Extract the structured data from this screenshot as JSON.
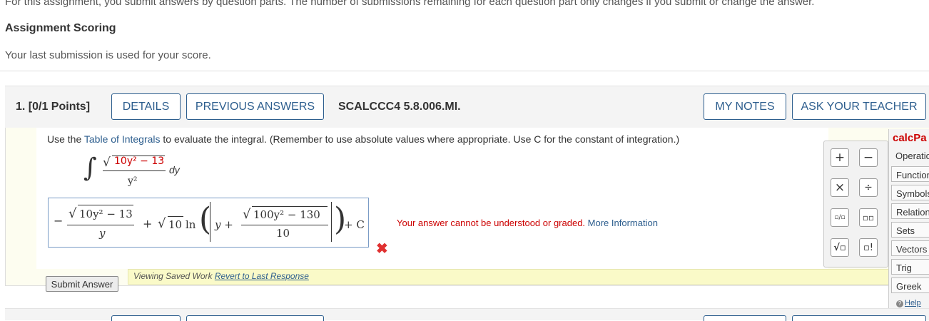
{
  "header": {
    "intro_text": "For this assignment, you submit answers by question parts. The number of submissions remaining for each question part only changes if you submit or change the answer.",
    "scoring_heading": "Assignment Scoring",
    "scoring_text": "Your last submission is used for your score."
  },
  "question": {
    "number_label": "1.  [0/1 Points]",
    "details_label": "DETAILS",
    "previous_answers_label": "PREVIOUS ANSWERS",
    "question_id": "SCALCCC4 5.8.006.MI.",
    "my_notes_label": "MY NOTES",
    "ask_teacher_label": "ASK YOUR TEACHER",
    "prompt_pre": "Use the ",
    "prompt_link": "Table of Integrals",
    "prompt_post": " to evaluate the integral. (Remember to use absolute values where appropriate. Use C for the constant of integration.)",
    "integral_numerator": "10y² − 13",
    "integral_denominator": "y²",
    "integral_dy": "dy",
    "answer": {
      "minus": "−",
      "frac1_num": "10y² − 13",
      "frac1_den": "y",
      "plus1": "+",
      "sqrt2": "10",
      "ln": "ln",
      "y_plus": "y +",
      "frac2_num": "100y² − 130",
      "frac2_den": "10",
      "plus_c": "+ C"
    },
    "feedback_text": "Your answer cannot be understood or graded. ",
    "feedback_link": "More Information",
    "saved_text": "Viewing Saved Work ",
    "revert_link": "Revert to Last Response",
    "submit_label": "Submit Answer"
  },
  "palette": {
    "keys": [
      "+",
      "−",
      "×",
      "÷",
      "▫/▫",
      "▫▫",
      "√▫",
      "▫!"
    ]
  },
  "calcpad": {
    "title": "calcPa",
    "items": [
      "Operatio",
      "Function",
      "Symbols",
      "Relation",
      "Sets",
      "Vectors",
      "Trig",
      "Greek"
    ],
    "help": "Help"
  }
}
